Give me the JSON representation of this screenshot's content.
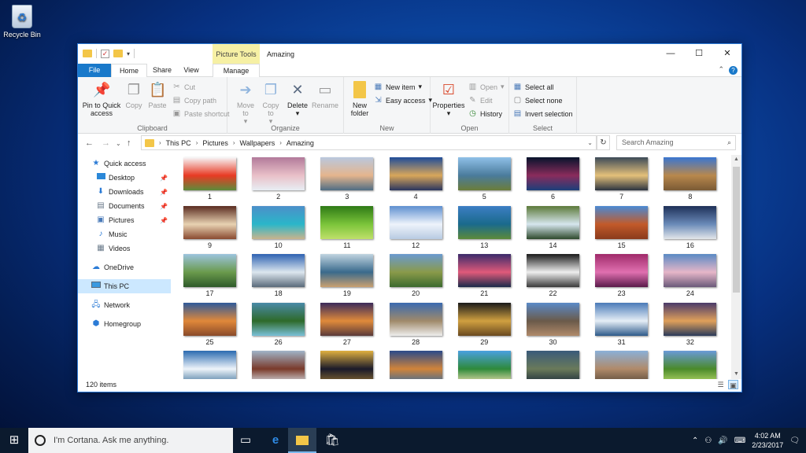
{
  "desktop": {
    "recycle_bin": "Recycle Bin"
  },
  "window": {
    "title": "Amazing",
    "context_tab": "Picture Tools",
    "controls": {
      "minimize": "—",
      "maximize": "☐",
      "close": "✕"
    }
  },
  "tabs": {
    "file": "File",
    "home": "Home",
    "share": "Share",
    "view": "View",
    "manage": "Manage"
  },
  "ribbon": {
    "clipboard": {
      "pin": "Pin to Quick access",
      "copy": "Copy",
      "paste": "Paste",
      "cut": "Cut",
      "copy_path": "Copy path",
      "paste_shortcut": "Paste shortcut",
      "label": "Clipboard"
    },
    "organize": {
      "move_to": "Move to",
      "copy_to": "Copy to",
      "delete": "Delete",
      "rename": "Rename",
      "label": "Organize"
    },
    "new": {
      "new_folder": "New folder",
      "new_item": "New item",
      "easy_access": "Easy access",
      "label": "New"
    },
    "open": {
      "properties": "Properties",
      "open": "Open",
      "edit": "Edit",
      "history": "History",
      "label": "Open"
    },
    "select": {
      "select_all": "Select all",
      "select_none": "Select none",
      "invert": "Invert selection",
      "label": "Select"
    }
  },
  "address": {
    "crumbs": [
      "This PC",
      "Pictures",
      "Wallpapers",
      "Amazing"
    ],
    "search_placeholder": "Search Amazing"
  },
  "nav": {
    "quick_access": "Quick access",
    "desktop": "Desktop",
    "downloads": "Downloads",
    "documents": "Documents",
    "pictures": "Pictures",
    "music": "Music",
    "videos": "Videos",
    "onedrive": "OneDrive",
    "this_pc": "This PC",
    "network": "Network",
    "homegroup": "Homegroup"
  },
  "thumbnails": [
    {
      "label": "1",
      "colors": [
        "#f7f7f9",
        "#e83a24",
        "#5c8b3a"
      ]
    },
    {
      "label": "2",
      "colors": [
        "#b27a9a",
        "#e9c0c8",
        "#e8eef4"
      ]
    },
    {
      "label": "3",
      "colors": [
        "#b9c8de",
        "#e5b58d",
        "#4f6d84"
      ]
    },
    {
      "label": "4",
      "colors": [
        "#1f4c99",
        "#d9a75a",
        "#2a355f"
      ]
    },
    {
      "label": "5",
      "colors": [
        "#8fc0e8",
        "#4a7b9c",
        "#6b7d3a"
      ]
    },
    {
      "label": "6",
      "colors": [
        "#07132c",
        "#8a2c5c",
        "#1c3e7a"
      ]
    },
    {
      "label": "7",
      "colors": [
        "#3c4a58",
        "#e4c07a",
        "#2c3440"
      ]
    },
    {
      "label": "8",
      "colors": [
        "#3a76d1",
        "#b8884d",
        "#7a5a35"
      ]
    },
    {
      "label": "9",
      "colors": [
        "#5a2c20",
        "#e8d2b2",
        "#8a4a30"
      ]
    },
    {
      "label": "10",
      "colors": [
        "#4c8fc9",
        "#2ab6c9",
        "#c9b48c"
      ]
    },
    {
      "label": "11",
      "colors": [
        "#2e7a16",
        "#7bc43a",
        "#bfe06a"
      ]
    },
    {
      "label": "12",
      "colors": [
        "#5e8fd0",
        "#eef3fb",
        "#b8cbe2"
      ]
    },
    {
      "label": "13",
      "colors": [
        "#3c7ec4",
        "#1a6a8c",
        "#5c8a3a"
      ]
    },
    {
      "label": "14",
      "colors": [
        "#5c7a3a",
        "#d6e6ee",
        "#2e4a2c"
      ]
    },
    {
      "label": "15",
      "colors": [
        "#4a8ad4",
        "#c25a2a",
        "#8a3a1c"
      ]
    },
    {
      "label": "16",
      "colors": [
        "#1e3058",
        "#6a8ab8",
        "#e3e6ea"
      ]
    },
    {
      "label": "17",
      "colors": [
        "#9cc4de",
        "#6a9a4c",
        "#2e5a2a"
      ]
    },
    {
      "label": "18",
      "colors": [
        "#2e62b2",
        "#dce6ee",
        "#5a6a7a"
      ]
    },
    {
      "label": "19",
      "colors": [
        "#c0d4e0",
        "#3a6a8c",
        "#c9a070"
      ]
    },
    {
      "label": "20",
      "colors": [
        "#6a9ad0",
        "#8a9a4a",
        "#3c6a2e"
      ]
    },
    {
      "label": "21",
      "colors": [
        "#3a2a6a",
        "#e05a7a",
        "#1a2a4a"
      ]
    },
    {
      "label": "22",
      "colors": [
        "#1a1a1a",
        "#eeeeee",
        "#3a3a3a"
      ]
    },
    {
      "label": "23",
      "colors": [
        "#a02a6a",
        "#e070b0",
        "#5a1a4a"
      ]
    },
    {
      "label": "24",
      "colors": [
        "#5a8ac4",
        "#e6b6c8",
        "#6a5a7a"
      ]
    },
    {
      "label": "25",
      "colors": [
        "#2e5a9a",
        "#e0883a",
        "#8a4a2a"
      ]
    },
    {
      "label": "26",
      "colors": [
        "#4a8aa8",
        "#2e6a2a",
        "#7ac0d8"
      ]
    },
    {
      "label": "27",
      "colors": [
        "#3a2a5a",
        "#e08a3a",
        "#5a3a3a"
      ]
    },
    {
      "label": "28",
      "colors": [
        "#3a6ab0",
        "#a08a6a",
        "#eeeeee"
      ]
    },
    {
      "label": "29",
      "colors": [
        "#1a1a1a",
        "#d0a040",
        "#6a4a20"
      ]
    },
    {
      "label": "30",
      "colors": [
        "#5a8ac8",
        "#6a5a4a",
        "#b08a6a"
      ]
    },
    {
      "label": "31",
      "colors": [
        "#4a7ab8",
        "#e6eef6",
        "#2e5a8a"
      ]
    },
    {
      "label": "32",
      "colors": [
        "#4a3a6a",
        "#e0a05a",
        "#2a3a5a"
      ]
    },
    {
      "label": "",
      "colors": [
        "#2a6ab0",
        "#eef4fa",
        "#4a7aa0"
      ]
    },
    {
      "label": "",
      "colors": [
        "#a0b4c8",
        "#7a3a2a",
        "#d8e2ea"
      ]
    },
    {
      "label": "",
      "colors": [
        "#e0b040",
        "#1a1a2a",
        "#8a6a30"
      ]
    },
    {
      "label": "",
      "colors": [
        "#2a4a8a",
        "#d0843a",
        "#3a6a9a"
      ]
    },
    {
      "label": "",
      "colors": [
        "#4aa0e0",
        "#2e8a3a",
        "#f0e0b0"
      ]
    },
    {
      "label": "",
      "colors": [
        "#3a5a7a",
        "#6a7a5a",
        "#1a2a3a"
      ]
    },
    {
      "label": "",
      "colors": [
        "#8ab0d8",
        "#b08a6a",
        "#5a4a3a"
      ]
    },
    {
      "label": "",
      "colors": [
        "#6a9ad8",
        "#4a8a2a",
        "#b8d86a"
      ]
    }
  ],
  "status": {
    "items": "120 items"
  },
  "taskbar": {
    "cortana_placeholder": "I'm Cortana. Ask me anything.",
    "time": "4:02 AM",
    "date": "2/23/2017"
  },
  "colors": {
    "accent": "#1979ca",
    "selection": "#cce8ff",
    "context_tab": "#f6f0a4"
  }
}
